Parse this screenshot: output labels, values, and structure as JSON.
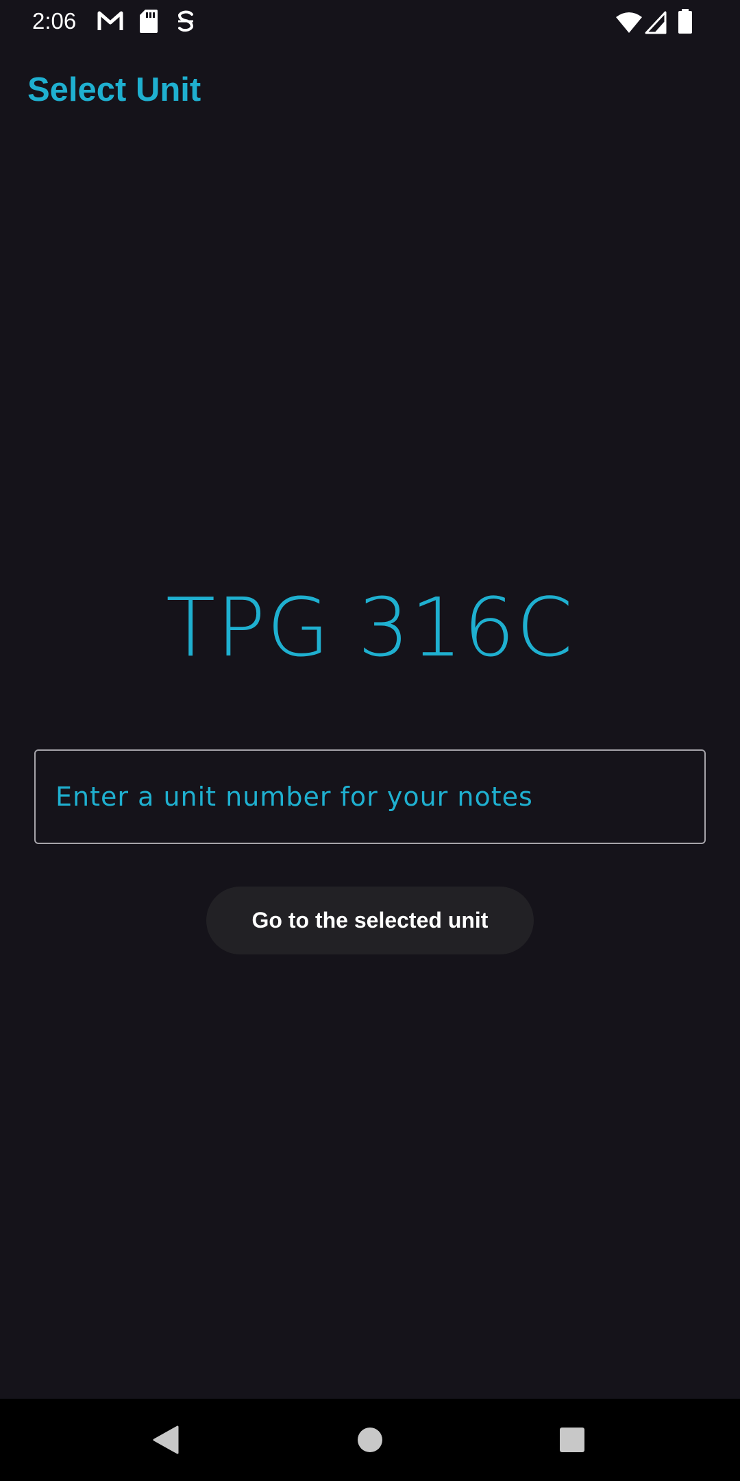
{
  "status_bar": {
    "time": "2:06",
    "left_icons": [
      "gmail-icon",
      "sd-card-icon",
      "sync-app-icon"
    ],
    "right_icons": [
      "wifi-icon",
      "cell-signal-icon",
      "battery-icon"
    ]
  },
  "app_bar": {
    "title": "Select Unit"
  },
  "main": {
    "selected_unit": "TPG 316C",
    "unit_input": {
      "value": "",
      "placeholder": "Enter a unit number for your notes"
    },
    "go_button_label": "Go to the selected unit"
  },
  "nav_bar": {
    "buttons": [
      "back-icon",
      "home-icon",
      "recents-icon"
    ]
  },
  "colors": {
    "background": "#15131a",
    "accent": "#1fb0d0",
    "button_bg": "#222125",
    "nav_bg": "#000000"
  }
}
